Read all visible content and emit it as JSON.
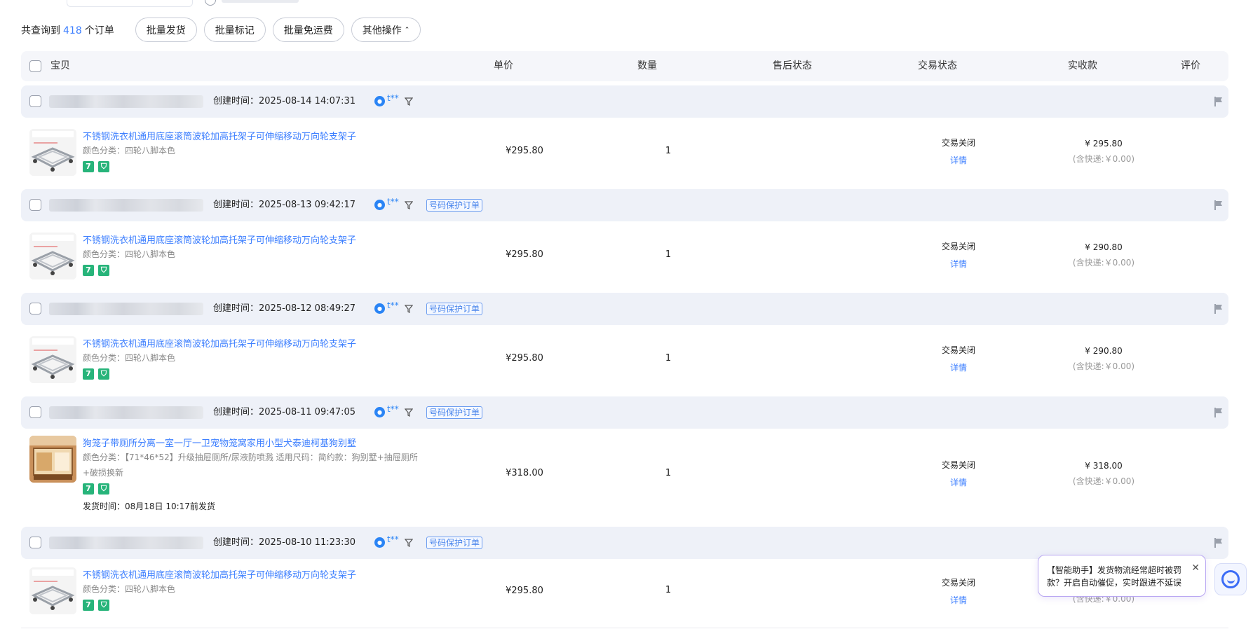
{
  "toolbar": {
    "summary_prefix": "共查询到",
    "total": "418",
    "summary_suffix": "个订单",
    "buttons": [
      {
        "label": "批量发货"
      },
      {
        "label": "批量标记"
      },
      {
        "label": "批量免运费"
      },
      {
        "label": "其他操作",
        "chevron": "⌃"
      }
    ]
  },
  "table_header": {
    "item": "宝贝",
    "unit_price": "单价",
    "quantity": "数量",
    "after_sale": "售后状态",
    "trade_status": "交易状态",
    "received": "实收款",
    "review": "评价"
  },
  "orders": [
    {
      "created": "创建时间：2025-08-14 14:07:31",
      "buyer": "t**",
      "protect_tag": "",
      "title": "不锈钢洗衣机通用底座滚筒波轮加高托架子可伸缩移动万向轮支架子",
      "attr": "颜色分类：四轮八脚本色",
      "attr_cont": "",
      "ship_time": "",
      "price": "¥295.80",
      "qty": "1",
      "status": "交易关闭",
      "detail": "详情",
      "paid": "¥ 295.80",
      "ship_fee": "(含快递:￥0.00)"
    },
    {
      "created": "创建时间：2025-08-13 09:42:17",
      "buyer": "t**",
      "protect_tag": "号码保护订单",
      "title": "不锈钢洗衣机通用底座滚筒波轮加高托架子可伸缩移动万向轮支架子",
      "attr": "颜色分类：四轮八脚本色",
      "attr_cont": "",
      "ship_time": "",
      "price": "¥295.80",
      "qty": "1",
      "status": "交易关闭",
      "detail": "详情",
      "paid": "¥ 290.80",
      "ship_fee": "(含快递:￥0.00)"
    },
    {
      "created": "创建时间：2025-08-12 08:49:27",
      "buyer": "t**",
      "protect_tag": "号码保护订单",
      "title": "不锈钢洗衣机通用底座滚筒波轮加高托架子可伸缩移动万向轮支架子",
      "attr": "颜色分类：四轮八脚本色",
      "attr_cont": "",
      "ship_time": "",
      "price": "¥295.80",
      "qty": "1",
      "status": "交易关闭",
      "detail": "详情",
      "paid": "¥ 290.80",
      "ship_fee": "(含快递:￥0.00)"
    },
    {
      "created": "创建时间：2025-08-11 09:47:05",
      "buyer": "t**",
      "protect_tag": "号码保护订单",
      "title": "狗笼子带厕所分离一室一厅一卫宠物笼窝家用小型犬泰迪柯基狗别墅",
      "attr": "颜色分类：【71*46*52】升级抽屉厕所/尿液防喷溅  适用尺码：简约款：狗别墅+抽屉厕所",
      "attr_cont": "+破损换新",
      "ship_time": "发货时间：08月18日 10:17前发货",
      "price": "¥318.00",
      "qty": "1",
      "status": "交易关闭",
      "detail": "详情",
      "paid": "¥ 318.00",
      "ship_fee": "(含快递:￥0.00)"
    },
    {
      "created": "创建时间：2025-08-10 11:23:30",
      "buyer": "t**",
      "protect_tag": "号码保护订单",
      "title": "不锈钢洗衣机通用底座滚筒波轮加高托架子可伸缩移动万向轮支架子",
      "attr": "颜色分类：四轮八脚本色",
      "attr_cont": "",
      "ship_time": "",
      "price": "¥295.80",
      "qty": "1",
      "status": "交易关闭",
      "detail": "详情",
      "paid": "",
      "ship_fee": "(含快递:￥0.00)"
    }
  ],
  "assistant": {
    "message": "【智能助手】发货物流经常超时被罚款？开启自动催促，实时跟进不延误",
    "close": "✕"
  },
  "colors": {
    "accent": "#3d7fff",
    "order_header_bg": "#eef1f8",
    "badge_green": "#27b47a"
  }
}
